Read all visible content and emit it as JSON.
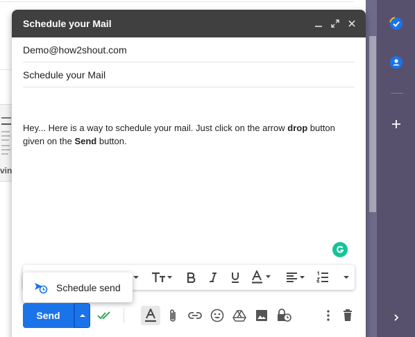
{
  "compose": {
    "title": "Schedule your Mail",
    "to_value": "Demo@how2shout.com",
    "subject_value": "Schedule your Mail",
    "body": {
      "part1": "Hey... Here is a way to schedule your mail. Just click on the arrow ",
      "bold1": "drop",
      "part2": " button given on the ",
      "bold2": "Send",
      "part3": " button."
    }
  },
  "schedule_menu": {
    "label": "Schedule send"
  },
  "bottom_bar": {
    "send_label": "Send"
  },
  "background": {
    "fragment": "vin"
  },
  "colors": {
    "header": "#404040",
    "accent": "#1a73e8",
    "side_panel": "#57516d",
    "grammarly": "#15c39a"
  },
  "icons": {
    "header": [
      "minimize-icon",
      "expand-icon",
      "close-icon"
    ],
    "side_panel": [
      "tasks-icon",
      "contacts-icon",
      "add-icon",
      "chevron-right-icon"
    ],
    "formatting": [
      "font-size-icon",
      "bold-icon",
      "italic-icon",
      "underline-icon",
      "text-color-icon",
      "align-icon",
      "numbered-list-icon",
      "more-formatting-icon"
    ],
    "bottom_bar": [
      "schedule-dropdown-icon",
      "read-receipt-icon",
      "formatting-toggle-icon",
      "attach-icon",
      "link-icon",
      "emoji-icon",
      "drive-icon",
      "photo-icon",
      "confidential-icon",
      "more-options-icon",
      "discard-icon"
    ]
  }
}
